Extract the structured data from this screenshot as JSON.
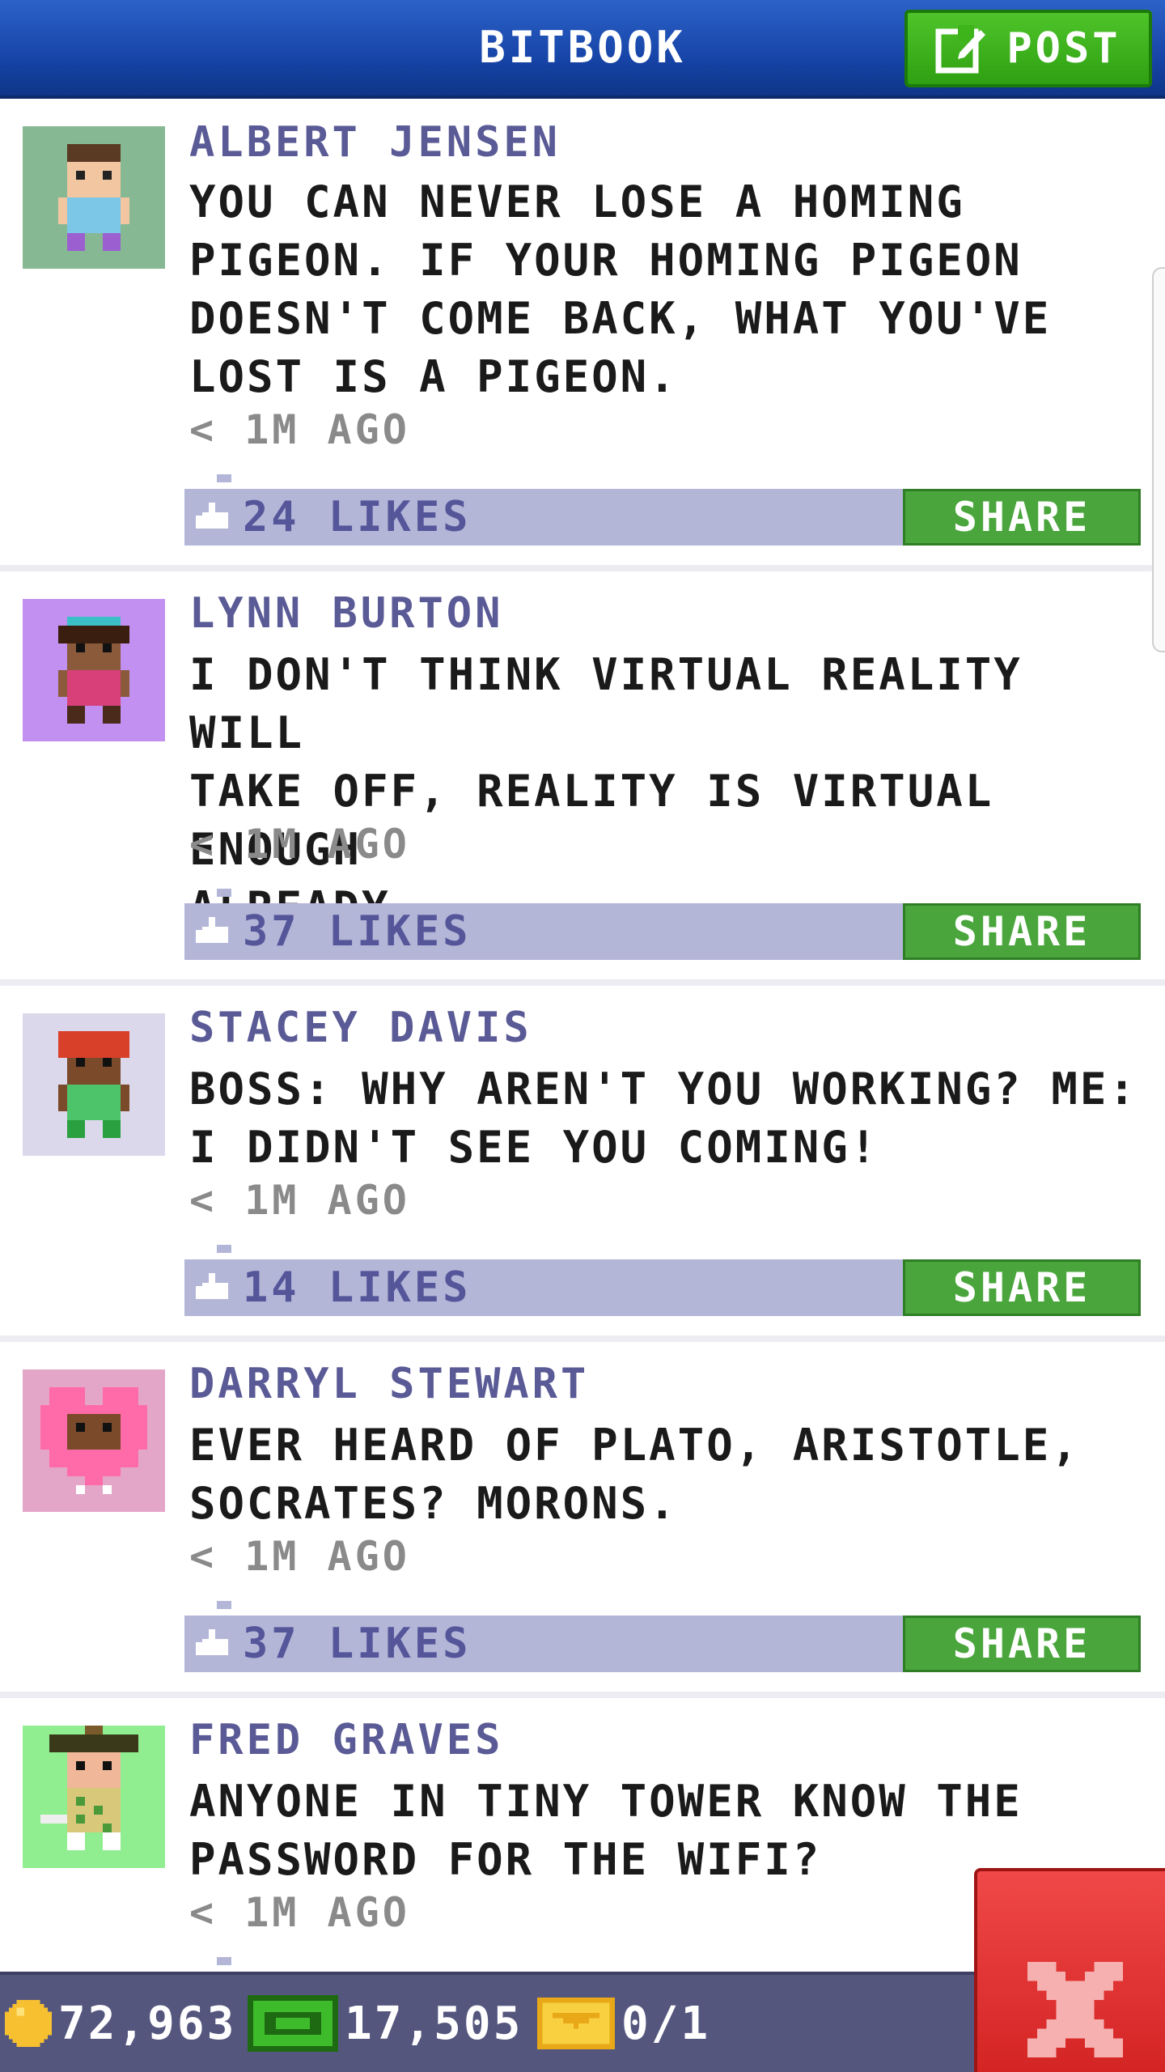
{
  "header": {
    "title": "BITBOOK",
    "post_label": "POST"
  },
  "posts": [
    {
      "author": "ALBERT JENSEN",
      "text_lines": [
        "YOU CAN NEVER LOSE A HOMING",
        "PIGEON. IF YOUR HOMING PIGEON",
        "DOESN'T COME BACK, WHAT YOU'VE",
        "LOST IS A PIGEON."
      ],
      "time": "< 1M AGO",
      "likes": "24 LIKES",
      "share_label": "SHARE",
      "avatar_bg": "#87b894"
    },
    {
      "author": "LYNN BURTON",
      "text_lines": [
        "I DON'T THINK VIRTUAL REALITY WILL",
        "TAKE OFF, REALITY IS VIRTUAL ENOUGH",
        "ALREADY."
      ],
      "time": "< 1M AGO",
      "likes": "37 LIKES",
      "share_label": "SHARE",
      "avatar_bg": "#c190f0"
    },
    {
      "author": "STACEY DAVIS",
      "text_lines": [
        "BOSS: WHY AREN'T YOU WORKING? ME:",
        "I DIDN'T SEE YOU COMING!"
      ],
      "time": "< 1M AGO",
      "likes": "14 LIKES",
      "share_label": "SHARE",
      "avatar_bg": "#dcd8ec"
    },
    {
      "author": "DARRYL STEWART",
      "text_lines": [
        "EVER HEARD OF PLATO, ARISTOTLE,",
        "SOCRATES? MORONS."
      ],
      "time": "< 1M AGO",
      "likes": "37 LIKES",
      "share_label": "SHARE",
      "avatar_bg": "#e4a6c8"
    },
    {
      "author": "FRED GRAVES",
      "text_lines": [
        "ANYONE IN TINY TOWER KNOW THE",
        "PASSWORD FOR THE WIFI?"
      ],
      "time": "< 1M AGO",
      "avatar_bg": "#90ee90"
    }
  ],
  "footer": {
    "coins": "72,963",
    "bux": "17,505",
    "tickets": "0/1"
  },
  "colors": {
    "header_blue": "#1745a8",
    "post_green": "#3db41a",
    "like_bar": "#b4b6d8",
    "share_green": "#4aa63c",
    "footer": "#55567e",
    "close_red": "#e03030"
  },
  "icons": [
    "edit-icon",
    "like-icon",
    "coin-icon",
    "bux-icon",
    "ticket-icon",
    "close-icon"
  ]
}
